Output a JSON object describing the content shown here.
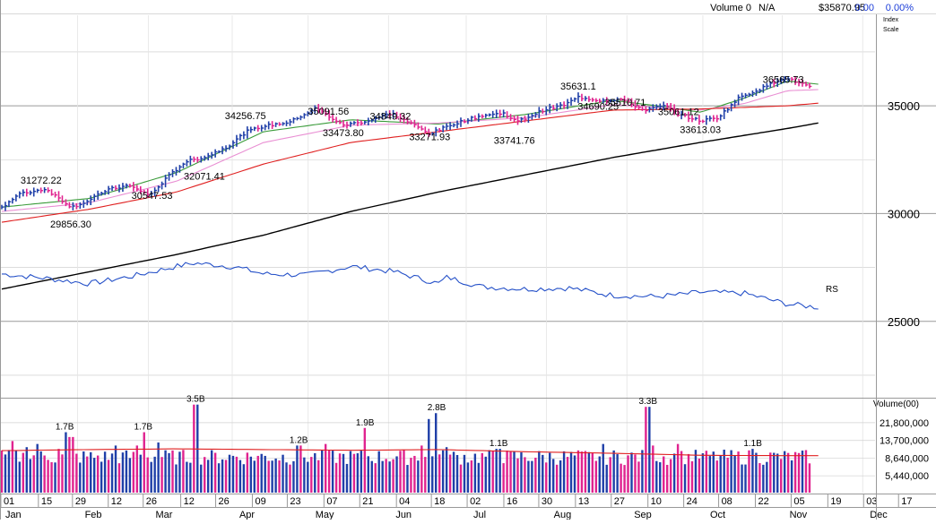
{
  "header": {
    "volume_label": "Volume 0",
    "na_label": "N/A",
    "price": "$35870.95",
    "change": "0.00",
    "change_pct": "0.00%",
    "scale_line1": "Index",
    "scale_line2": "Scale"
  },
  "colors": {
    "up_bar": "#1f3fa8",
    "down_bar": "#e0238f",
    "ma_fast": "#3a9b3a",
    "ma_mid": "#e98fd3",
    "ma_slow": "#e02020",
    "ma_long": "#000000",
    "rs_line": "#2450c8",
    "volume_ma": "#e02020",
    "grid": "#c8c8c8",
    "change_blue": "#1a3cd8"
  },
  "chart_data": [
    {
      "type": "line",
      "name": "price",
      "yscale": "linear",
      "ylim": [
        21500,
        39200
      ],
      "y_ticks": [
        25000,
        30000,
        35000
      ],
      "y_tick_labels": [
        "25000",
        "30000",
        "35000"
      ],
      "grid": true,
      "rs_label": "RS",
      "annotations": [
        {
          "label": "31272.22",
          "x": 0.045,
          "y": 31272.22
        },
        {
          "label": "29856.30",
          "x": 0.079,
          "y": 29856.3
        },
        {
          "label": "30547.53",
          "x": 0.172,
          "y": 30547.53
        },
        {
          "label": "32071.41",
          "x": 0.232,
          "y": 32071.41
        },
        {
          "label": "34256.75",
          "x": 0.279,
          "y": 34256.75
        },
        {
          "label": "35091.56",
          "x": 0.374,
          "y": 35091.56
        },
        {
          "label": "33473.80",
          "x": 0.391,
          "y": 33473.8
        },
        {
          "label": "34849.32",
          "x": 0.445,
          "y": 34849.32
        },
        {
          "label": "33271.93",
          "x": 0.49,
          "y": 33271.93
        },
        {
          "label": "33741.76",
          "x": 0.587,
          "y": 33741.76
        },
        {
          "label": "35631.1",
          "x": 0.66,
          "y": 35631.1
        },
        {
          "label": "35510.71",
          "x": 0.714,
          "y": 35510.71
        },
        {
          "label": "34690.25",
          "x": 0.683,
          "y": 34690.25
        },
        {
          "label": "35061.12",
          "x": 0.775,
          "y": 35061.12
        },
        {
          "label": "33613.03",
          "x": 0.8,
          "y": 33613.03
        },
        {
          "label": "36565.73",
          "x": 0.895,
          "y": 36565.73
        }
      ],
      "anchors": {
        "x": [
          0.0,
          0.02,
          0.05,
          0.08,
          0.1,
          0.12,
          0.145,
          0.17,
          0.19,
          0.21,
          0.235,
          0.26,
          0.28,
          0.3,
          0.33,
          0.36,
          0.375,
          0.39,
          0.42,
          0.445,
          0.47,
          0.49,
          0.52,
          0.55,
          0.575,
          0.59,
          0.62,
          0.645,
          0.66,
          0.685,
          0.71,
          0.735,
          0.76,
          0.775,
          0.8,
          0.82,
          0.845,
          0.87,
          0.895,
          0.915,
          0.925
        ],
        "close": [
          30300,
          30900,
          31150,
          30300,
          30600,
          31100,
          31300,
          30850,
          31700,
          32400,
          32650,
          33150,
          33800,
          34050,
          34250,
          34900,
          34500,
          34100,
          34300,
          34650,
          34150,
          33700,
          34200,
          34550,
          34650,
          34250,
          34800,
          35050,
          35400,
          35250,
          35300,
          34800,
          35000,
          34600,
          34300,
          34450,
          35400,
          35800,
          36300,
          36050,
          35870.95
        ]
      },
      "moving_averages": [
        {
          "color_key": "ma_fast",
          "x": [
            0.0,
            0.1,
            0.2,
            0.3,
            0.4,
            0.5,
            0.6,
            0.7,
            0.75,
            0.8,
            0.85,
            0.9,
            0.935
          ],
          "y": [
            30300,
            30700,
            31900,
            33800,
            34350,
            34150,
            34600,
            35250,
            35000,
            34700,
            35350,
            36150,
            36000
          ]
        },
        {
          "color_key": "ma_mid",
          "x": [
            0.0,
            0.1,
            0.2,
            0.3,
            0.4,
            0.5,
            0.6,
            0.7,
            0.8,
            0.85,
            0.9,
            0.935
          ],
          "y": [
            30100,
            30500,
            31500,
            33300,
            34100,
            34200,
            34450,
            35050,
            34800,
            35100,
            35700,
            35750
          ]
        },
        {
          "color_key": "ma_slow",
          "x": [
            0.0,
            0.1,
            0.2,
            0.3,
            0.4,
            0.5,
            0.6,
            0.7,
            0.8,
            0.9,
            0.935
          ],
          "y": [
            29600,
            30200,
            31000,
            32300,
            33300,
            33800,
            34300,
            34800,
            34850,
            35000,
            35120
          ]
        },
        {
          "color_key": "ma_long",
          "x": [
            0.0,
            0.1,
            0.2,
            0.3,
            0.4,
            0.5,
            0.6,
            0.7,
            0.8,
            0.9,
            0.935
          ],
          "y": [
            26500,
            27300,
            28100,
            29000,
            30100,
            31000,
            31800,
            32600,
            33300,
            33950,
            34200
          ]
        },
        {
          "color_key": "rs_line",
          "x": [
            0.0,
            0.05,
            0.1,
            0.15,
            0.2,
            0.22,
            0.25,
            0.27,
            0.3,
            0.35,
            0.4,
            0.45,
            0.5,
            0.51,
            0.55,
            0.6,
            0.65,
            0.7,
            0.75,
            0.78,
            0.8,
            0.85,
            0.9,
            0.935
          ],
          "y": [
            27200,
            27000,
            26750,
            27100,
            27550,
            27700,
            27600,
            27500,
            27200,
            27150,
            27550,
            27300,
            26750,
            27050,
            26600,
            26500,
            26550,
            26200,
            26150,
            26250,
            26350,
            26300,
            25800,
            25650
          ]
        }
      ]
    },
    {
      "type": "bar",
      "name": "volume",
      "ylabel": "Volume(00)",
      "yscale": "log",
      "ylim": [
        3500000,
        40000000
      ],
      "y_ticks": [
        5440000,
        8640000,
        13700000,
        21800000
      ],
      "y_tick_labels": [
        "5,440,000",
        "8,640,000",
        "13,700,000",
        "21,800,000"
      ],
      "labels": [
        {
          "label": "3.5B",
          "x": 0.222,
          "value": 35000000
        },
        {
          "label": "1.7B",
          "x": 0.072,
          "value": 17000000
        },
        {
          "label": "1.7B",
          "x": 0.162,
          "value": 17000000
        },
        {
          "label": "1.2B",
          "x": 0.34,
          "value": 12000000
        },
        {
          "label": "1.9B",
          "x": 0.416,
          "value": 19000000
        },
        {
          "label": "2.8B",
          "x": 0.498,
          "value": 28000000
        },
        {
          "label": "1.1B",
          "x": 0.569,
          "value": 11000000
        },
        {
          "label": "3.3B",
          "x": 0.74,
          "value": 33000000
        },
        {
          "label": "1.1B",
          "x": 0.86,
          "value": 11000000
        }
      ],
      "spikes": [
        {
          "x": 0.012,
          "value": 13500000
        },
        {
          "x": 0.028,
          "value": 11500000
        },
        {
          "x": 0.04,
          "value": 12500000
        },
        {
          "x": 0.066,
          "value": 11000000
        },
        {
          "x": 0.072,
          "value": 17000000
        },
        {
          "x": 0.08,
          "value": 15000000
        },
        {
          "x": 0.13,
          "value": 12000000
        },
        {
          "x": 0.155,
          "value": 12000000
        },
        {
          "x": 0.162,
          "value": 17000000
        },
        {
          "x": 0.18,
          "value": 13000000
        },
        {
          "x": 0.222,
          "value": 35000000
        },
        {
          "x": 0.34,
          "value": 12000000
        },
        {
          "x": 0.37,
          "value": 12500000
        },
        {
          "x": 0.416,
          "value": 19000000
        },
        {
          "x": 0.48,
          "value": 12000000
        },
        {
          "x": 0.488,
          "value": 24000000
        },
        {
          "x": 0.498,
          "value": 28000000
        },
        {
          "x": 0.51,
          "value": 11500000
        },
        {
          "x": 0.569,
          "value": 11000000
        },
        {
          "x": 0.69,
          "value": 12500000
        },
        {
          "x": 0.74,
          "value": 33000000
        },
        {
          "x": 0.745,
          "value": 12000000
        },
        {
          "x": 0.775,
          "value": 12500000
        },
        {
          "x": 0.86,
          "value": 11000000
        }
      ],
      "ma": {
        "x": [
          0.0,
          0.1,
          0.2,
          0.3,
          0.4,
          0.5,
          0.6,
          0.7,
          0.8,
          0.9,
          0.935
        ],
        "y": [
          10500000,
          10800000,
          11000000,
          10800000,
          10600000,
          10800000,
          10200000,
          9800000,
          9300000,
          9200000,
          9200000
        ]
      }
    }
  ],
  "x_axis": {
    "day_ticks": [
      {
        "label": "01",
        "x": 0.002
      },
      {
        "label": "15",
        "x": 0.045
      },
      {
        "label": "29",
        "x": 0.084
      },
      {
        "label": "12",
        "x": 0.125
      },
      {
        "label": "26",
        "x": 0.165
      },
      {
        "label": "12",
        "x": 0.208
      },
      {
        "label": "26",
        "x": 0.248
      },
      {
        "label": "09",
        "x": 0.29
      },
      {
        "label": "23",
        "x": 0.33
      },
      {
        "label": "07",
        "x": 0.372
      },
      {
        "label": "21",
        "x": 0.413
      },
      {
        "label": "04",
        "x": 0.455
      },
      {
        "label": "18",
        "x": 0.495
      },
      {
        "label": "02",
        "x": 0.536
      },
      {
        "label": "16",
        "x": 0.578
      },
      {
        "label": "30",
        "x": 0.618
      },
      {
        "label": "13",
        "x": 0.66
      },
      {
        "label": "27",
        "x": 0.701
      },
      {
        "label": "10",
        "x": 0.743
      },
      {
        "label": "24",
        "x": 0.784
      },
      {
        "label": "08",
        "x": 0.824
      },
      {
        "label": "22",
        "x": 0.866
      },
      {
        "label": "05",
        "x": 0.907
      },
      {
        "label": "19",
        "x": 0.949
      },
      {
        "label": "03",
        "x": 0.99
      },
      {
        "label": "17",
        "x": 1.03
      }
    ],
    "month_ticks": [
      {
        "label": "Jan",
        "x": 0.002
      },
      {
        "label": "Feb",
        "x": 0.093
      },
      {
        "label": "Mar",
        "x": 0.174
      },
      {
        "label": "Apr",
        "x": 0.27
      },
      {
        "label": "May",
        "x": 0.357
      },
      {
        "label": "Jun",
        "x": 0.449
      },
      {
        "label": "Jul",
        "x": 0.538
      },
      {
        "label": "Aug",
        "x": 0.63
      },
      {
        "label": "Sep",
        "x": 0.722
      },
      {
        "label": "Oct",
        "x": 0.809
      },
      {
        "label": "Nov",
        "x": 0.9
      },
      {
        "label": "Dec",
        "x": 0.992
      }
    ]
  }
}
